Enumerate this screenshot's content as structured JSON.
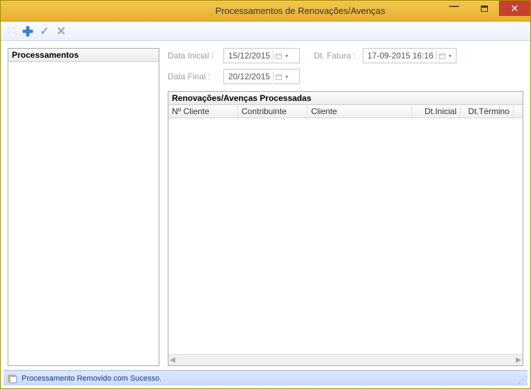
{
  "window": {
    "title": "Processamentos de Renovações/Avenças"
  },
  "toolbar": {
    "add_icon": "plus",
    "confirm_icon": "check",
    "cancel_icon": "x"
  },
  "left_panel": {
    "header": "Processamentos"
  },
  "filters": {
    "data_inicial_label": "Data Inicial :",
    "data_inicial_value": "15/12/2015",
    "data_final_label": "Data Final :",
    "data_final_value": "20/12/2015",
    "dt_fatura_label": "Dt. Fatura :",
    "dt_fatura_value": "17-09-2015 16:16"
  },
  "grid": {
    "title": "Renovações/Avenças Processadas",
    "columns": [
      "Nº Cliente",
      "Contribuinte",
      "Cliente",
      "Dt.Inicial",
      "Dt.Término"
    ],
    "rows": []
  },
  "status": {
    "message": "Processamento Removido com Sucesso."
  }
}
